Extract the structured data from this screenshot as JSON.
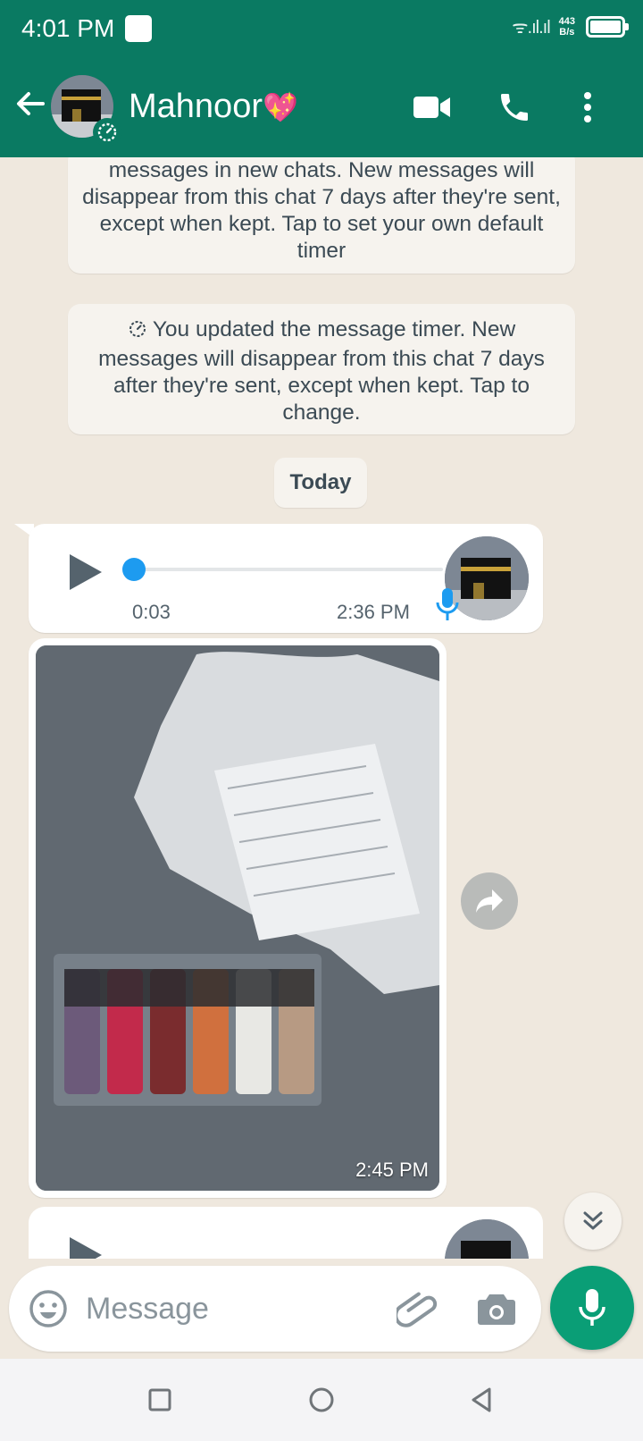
{
  "status_bar": {
    "time": "4:01 PM",
    "signal": "ᯤ.ıl.ıl",
    "net_speed_value": "443",
    "net_speed_unit": "B/s",
    "battery_level": 1.0
  },
  "header": {
    "contact_name": "Mahnoor",
    "contact_emoji": "💖",
    "icons": [
      "back-arrow-icon",
      "video-call-icon",
      "voice-call-icon",
      "more-options-icon"
    ],
    "color": "#0a7a62"
  },
  "chat": {
    "system_messages": [
      "messages in new chats. New messages will disappear from this chat 7 days after they're sent, except when kept. Tap to set your own default timer",
      "You updated the message timer. New messages will disappear from this chat 7 days after they're sent, except when kept. Tap to change."
    ],
    "date_chip": "Today",
    "voice_message": {
      "duration": "0:03",
      "time": "2:36 PM",
      "progress": 0.0
    },
    "image_message": {
      "time": "2:45 PM"
    }
  },
  "composer": {
    "placeholder": "Message"
  },
  "colors": {
    "accent": "#0a7a62",
    "mic_button": "#0a9e76",
    "voice_knob": "#1d9bf0"
  }
}
